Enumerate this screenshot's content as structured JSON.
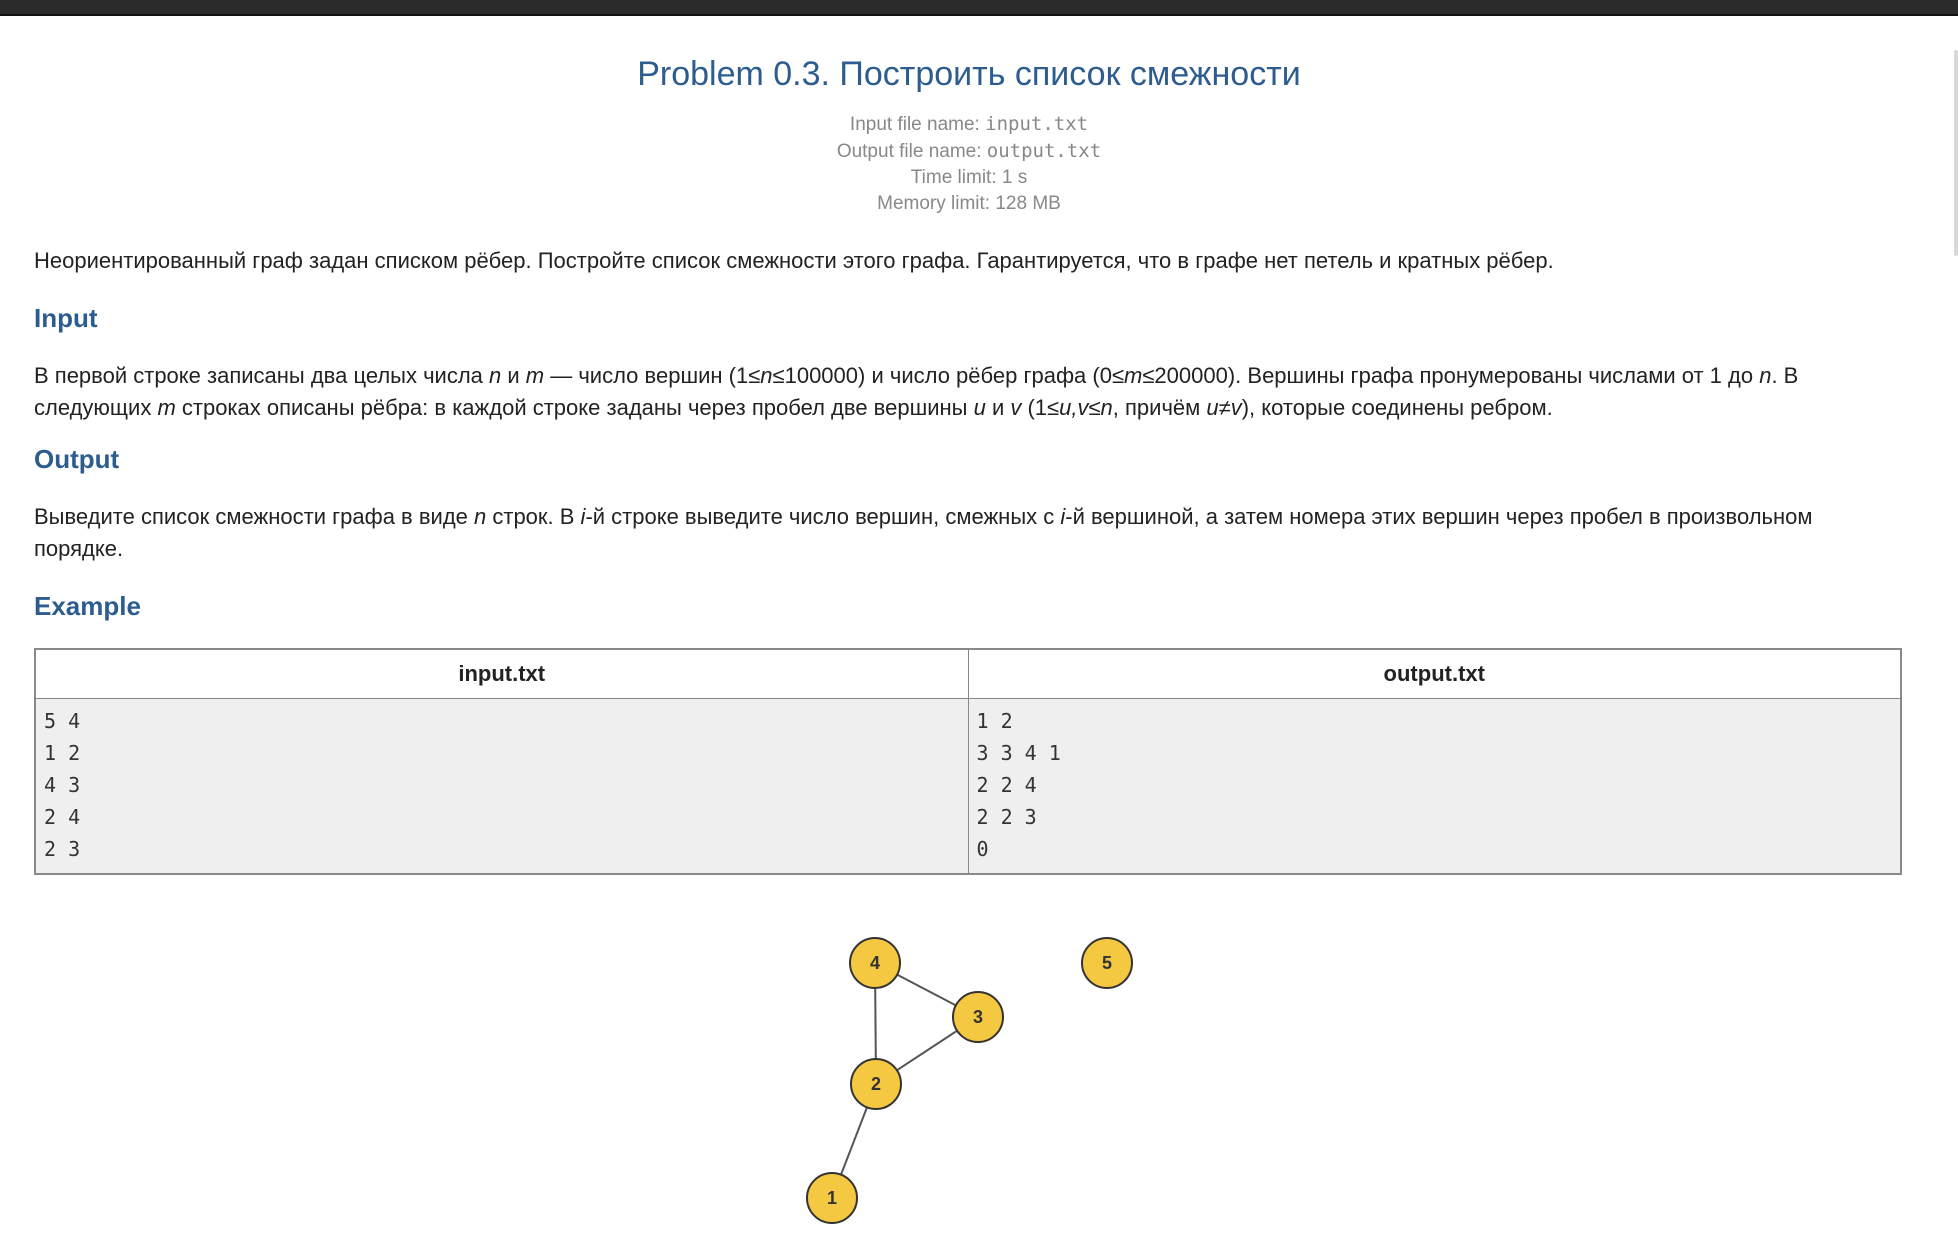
{
  "problem": {
    "title": "Problem 0.3. Построить список смежности",
    "input_file_label": "Input file name:",
    "input_file_name": "input.txt",
    "output_file_label": "Output file name:",
    "output_file_name": "output.txt",
    "time_limit": "Time limit: 1 s",
    "memory_limit": "Memory limit: 128 MB"
  },
  "statement": "Неориентированный граф задан списком рёбер. Постройте список смежности этого графа. Гарантируется, что в графе нет петель и кратных рёбер.",
  "input_section": {
    "heading": "Input",
    "p1": "В первой строке записаны два целых числа ",
    "n": "n",
    "and1": " и ",
    "m": "m",
    "p2": " — число вершин (1≤",
    "n2": "n",
    "p3": "≤100000) и число рёбер графа (0≤",
    "m2": "m",
    "p4": "≤200000). Вершины графа пронумерованы числами от 1 до ",
    "n3": "n",
    "p5": ". В следующих ",
    "m3": "m",
    "p6": " строках описаны рёбра: в каждой строке заданы через пробел две вершины ",
    "u": "u",
    "and2": " и ",
    "v": "v",
    "p7": " (1≤",
    "uv": "u,v≤n",
    "p8": ", причём ",
    "uneqv": "u≠v",
    "p9": "), которые соединены ребром."
  },
  "output_section": {
    "heading": "Output",
    "p1": "Выведите список смежности графа в виде ",
    "n": "n",
    "p2": " строк. В ",
    "i1": "i",
    "p3": "-й строке выведите число вершин, смежных с ",
    "i2": "i",
    "p4": "-й вершиной, а затем номера этих вершин через пробел в произвольном порядке."
  },
  "example": {
    "heading": "Example",
    "input_header": "input.txt",
    "output_header": "output.txt",
    "input_lines": [
      "5 4",
      "1 2",
      "4 3",
      "2 4",
      "2 3"
    ],
    "output_lines": [
      "1 2",
      "3 3 4 1",
      "2 2 4",
      "2 2 3",
      "0"
    ]
  },
  "graph": {
    "node_color": "#f5c842",
    "node_border": "#333333",
    "nodes": [
      "1",
      "2",
      "3",
      "4",
      "5"
    ],
    "edges": [
      [
        "1",
        "2"
      ],
      [
        "2",
        "4"
      ],
      [
        "2",
        "3"
      ],
      [
        "4",
        "3"
      ]
    ]
  }
}
